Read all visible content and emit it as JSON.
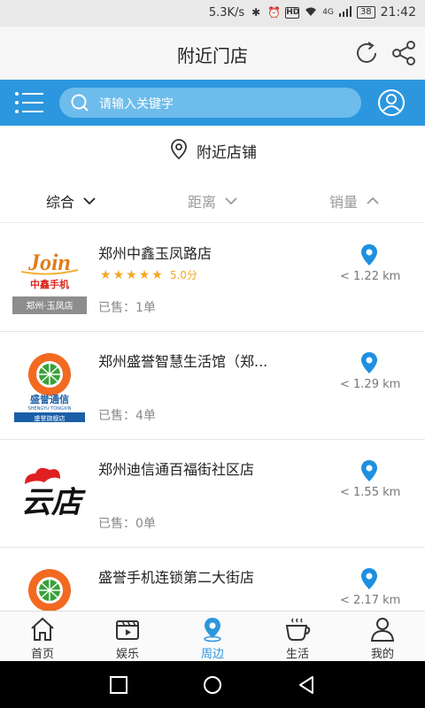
{
  "status_bar": {
    "net_speed": "5.3K/s",
    "hd": "HD",
    "network": "4G",
    "battery": "38",
    "time": "21:42"
  },
  "header": {
    "title": "附近门店"
  },
  "search": {
    "placeholder": "请输入关键字"
  },
  "nearby": {
    "label": "附近店铺"
  },
  "sort": {
    "items": [
      {
        "label": "综合",
        "arrow": "down"
      },
      {
        "label": "距离",
        "arrow": "down"
      },
      {
        "label": "销量",
        "arrow": "up"
      }
    ]
  },
  "stores": [
    {
      "name": "郑州中鑫玉凤路店",
      "rating_stars": 5,
      "rating_text": "5.0分",
      "sold": "已售：1单",
      "distance": "< 1.22 km",
      "logo": {
        "top_text": "Join",
        "mid_text": "中鑫手机",
        "bottom_text": "郑州·玉凤店"
      }
    },
    {
      "name": "郑州盛誉智慧生活馆（郑...",
      "sold": "已售：4单",
      "distance": "< 1.29 km",
      "logo": {
        "mid_text": "盛誉通信",
        "sub_text": "SHENGYU TONGXIN",
        "bottom_text": "盛誉旗舰店"
      }
    },
    {
      "name": "郑州迪信通百福街社区店",
      "sold": "已售：0单",
      "distance": "< 1.55 km",
      "logo": {
        "mid_text": "云店"
      }
    },
    {
      "name": "盛誉手机连锁第二大街店",
      "sold": "",
      "distance": "< 2.17 km",
      "logo": {}
    }
  ],
  "bottom_nav": {
    "items": [
      {
        "label": "首页",
        "icon": "home-icon"
      },
      {
        "label": "娱乐",
        "icon": "video-icon"
      },
      {
        "label": "周边",
        "icon": "location-icon",
        "active": true
      },
      {
        "label": "生活",
        "icon": "coffee-icon"
      },
      {
        "label": "我的",
        "icon": "person-icon"
      }
    ]
  },
  "colors": {
    "accent": "#2c97de",
    "star": "#f5a623"
  }
}
